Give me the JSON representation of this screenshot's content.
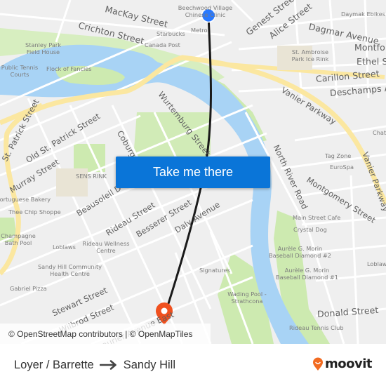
{
  "map": {
    "origin_marker": "origin-dot",
    "destination_marker": "destination-pin",
    "streets": [
      {
        "name": "MacKay Street",
        "key": "mackay"
      },
      {
        "name": "Crichton Street",
        "key": "crichton"
      },
      {
        "name": "Genest Street",
        "key": "genest"
      },
      {
        "name": "Alice Street",
        "key": "alice"
      },
      {
        "name": "Dagmar Avenue",
        "key": "dagmar"
      },
      {
        "name": "Montfort",
        "key": "montfort"
      },
      {
        "name": "Ethel St",
        "key": "ethel"
      },
      {
        "name": "Carillon Street",
        "key": "carillon"
      },
      {
        "name": "Deschamps Av",
        "key": "deschamps"
      },
      {
        "name": "Vanier Parkway",
        "key": "vanier1"
      },
      {
        "name": "Vanier Parkway",
        "key": "vanier2"
      },
      {
        "name": "Wurtemburg Street",
        "key": "wurtemburg"
      },
      {
        "name": "St. Patrick Street",
        "key": "stpatrick"
      },
      {
        "name": "Old St. Patrick Street",
        "key": "oldstpatrick"
      },
      {
        "name": "Coburg",
        "key": "coburg"
      },
      {
        "name": "Murray Street",
        "key": "murray"
      },
      {
        "name": "Beausoleil D",
        "key": "beausoleil"
      },
      {
        "name": "Rideau Street",
        "key": "rideau"
      },
      {
        "name": "Besserer Street",
        "key": "besserer"
      },
      {
        "name": "Daly Avenue",
        "key": "daly"
      },
      {
        "name": "North River Road",
        "key": "northriver"
      },
      {
        "name": "Montgomery Street",
        "key": "montgomery"
      },
      {
        "name": "Stewart Street",
        "key": "stewart"
      },
      {
        "name": "Wilbrod Street",
        "key": "wilbrod"
      },
      {
        "name": "Laurier Avenue East",
        "key": "laurier"
      },
      {
        "name": "Donald Street",
        "key": "donald"
      },
      {
        "name": "Street",
        "key": "street_nw"
      },
      {
        "name": "Cumberland",
        "key": "cumberland"
      }
    ],
    "places": [
      "Beechwood Village Chinese Clinic",
      "Metro",
      "Starbucks",
      "Canada Post",
      "Stanley Park Field House",
      "Public Tennis Courts",
      "Flock of Fancies",
      "Daymak Ebikes",
      "St. Ambroise Park Ice Rink",
      "Chat",
      "Tag Zone",
      "EuroSpa",
      "SENS RINK",
      "Portuguese Bakery",
      "Thee Chip Shoppe",
      "Champagne Bath Pool",
      "Loblaws",
      "Rideau Wellness Centre",
      "Sandy Hill Community Health Centre",
      "Gabriel Pizza",
      "Main Street Cafe",
      "Crystal Dog",
      "Aurèle G. Morin Baseball Diamond #2",
      "Aurèle G. Morin Baseball Diamond #1",
      "Loblaws",
      "Signatures",
      "Wading Pool - Strathcona",
      "Rideau Tennis Club"
    ],
    "cta_label": "Take me there",
    "attribution": "© OpenStreetMap contributors | © OpenMapTiles"
  },
  "footer": {
    "origin": "Loyer / Barrette",
    "destination": "Sandy Hill",
    "arrow_icon": "arrow-right-icon",
    "brand": "moovit",
    "brand_color": "#f26b21"
  },
  "colors": {
    "cta_bg": "#0a75d8",
    "route_line": "#1a1a1a",
    "origin_dot": "#2979ff",
    "destination_pin": "#f0501e",
    "water": "#a8d3f5",
    "park": "#cdeab0",
    "major_road": "#fbe7a0"
  }
}
